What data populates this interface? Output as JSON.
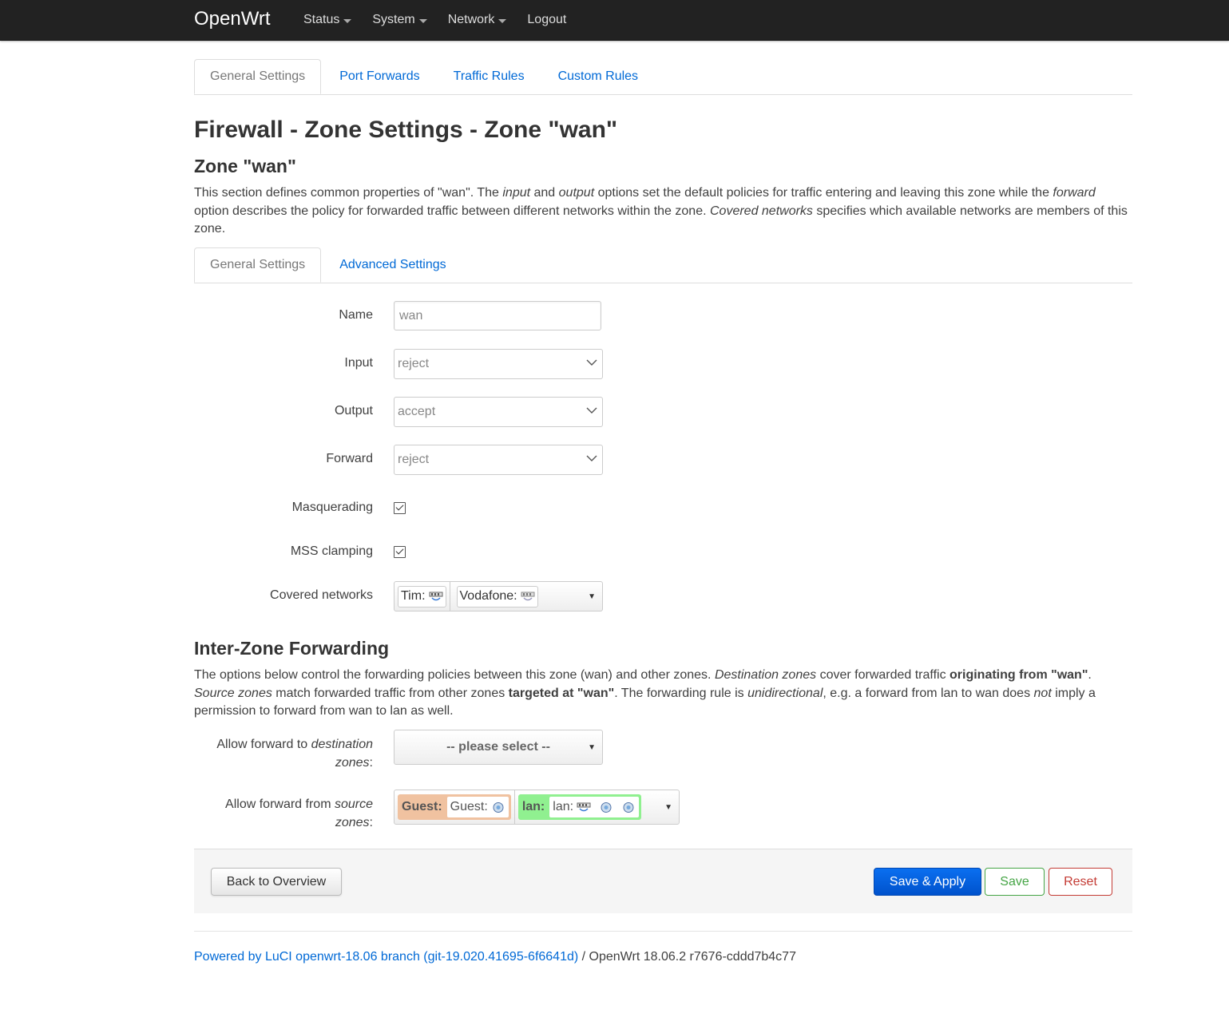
{
  "brand": "OpenWrt",
  "nav": {
    "status": "Status",
    "system": "System",
    "network": "Network",
    "logout": "Logout"
  },
  "top_tabs": [
    "General Settings",
    "Port Forwards",
    "Traffic Rules",
    "Custom Rules"
  ],
  "page_title": "Firewall - Zone Settings - Zone \"wan\"",
  "section_title": "Zone \"wan\"",
  "section_desc": {
    "p1": "This section defines common properties of \"wan\". The ",
    "i1": "input",
    "p2": " and ",
    "i2": "output",
    "p3": " options set the default policies for traffic entering and leaving this zone while the ",
    "i3": "forward",
    "p4": " option describes the policy for forwarded traffic between different networks within the zone. ",
    "i4": "Covered networks",
    "p5": " specifies which available networks are members of this zone."
  },
  "sub_tabs": [
    "General Settings",
    "Advanced Settings"
  ],
  "form": {
    "name_label": "Name",
    "name_value": "wan",
    "input_label": "Input",
    "input_value": "reject",
    "output_label": "Output",
    "output_value": "accept",
    "forward_label": "Forward",
    "forward_value": "reject",
    "masq_label": "Masquerading",
    "masq_checked": true,
    "mss_label": "MSS clamping",
    "mss_checked": true,
    "covered_label": "Covered networks",
    "covered": [
      "Tim:",
      "Vodafone:"
    ]
  },
  "izf": {
    "title": "Inter-Zone Forwarding",
    "d1": "The options below control the forwarding policies between this zone (wan) and other zones. ",
    "di1": "Destination zones",
    "d2": " cover forwarded traffic ",
    "db1": "originating from \"wan\"",
    "d3": ". ",
    "di2": "Source zones",
    "d4": " match forwarded traffic from other zones ",
    "db2": "targeted at \"wan\"",
    "d5": ". The forwarding rule is ",
    "di3": "unidirectional",
    "d6": ", e.g. a forward from lan to wan does ",
    "di4": "not",
    "d7": " imply a permission to forward from wan to lan as well.",
    "dest_label_a": "Allow forward to ",
    "dest_label_i": "destination",
    "dest_label_b": "zones",
    "dest_placeholder": "-- please select --",
    "src_label_a": "Allow forward from ",
    "src_label_i": "source",
    "src_label_b": "zones",
    "src_zones": [
      {
        "name": "Guest:",
        "net": "Guest:",
        "color": "#f0c2a0"
      },
      {
        "name": "lan:",
        "net": "lan:",
        "color": "#90f090"
      }
    ]
  },
  "buttons": {
    "back": "Back to Overview",
    "apply": "Save & Apply",
    "save": "Save",
    "reset": "Reset"
  },
  "footer": {
    "link": "Powered by LuCI openwrt-18.06 branch (git-19.020.41695-6f6641d)",
    "rest": " / OpenWrt 18.06.2 r7676-cddd7b4c77"
  }
}
